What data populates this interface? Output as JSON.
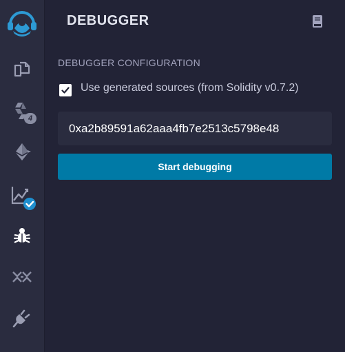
{
  "icon_bar": {
    "items": [
      {
        "name": "remix-logo-icon"
      },
      {
        "name": "file-explorer-icon"
      },
      {
        "name": "solidity-compiler-icon",
        "badge": "4"
      },
      {
        "name": "deploy-run-icon"
      },
      {
        "name": "analysis-icon",
        "badge": "check"
      },
      {
        "name": "debugger-icon",
        "active": true
      },
      {
        "name": "tests-icon"
      },
      {
        "name": "plugin-manager-icon"
      }
    ]
  },
  "panel": {
    "title": "DEBUGGER",
    "doc_icon": "documentation-icon",
    "section_label": "DEBUGGER CONFIGURATION",
    "checkbox": {
      "checked": true,
      "label": "Use generated sources (from Solidity v0.7.2)"
    },
    "tx_input": {
      "value": "0xa2b89591a62aaa4fb7e2513c5798e48",
      "placeholder": ""
    },
    "start_button": "Start debugging"
  },
  "colors": {
    "background": "#222336",
    "sidebar": "#2a2c3f",
    "accent": "#007aa6",
    "logo": "#2d9ad4",
    "check_badge": "#1e8fcf",
    "text_primary": "#e2e4ee",
    "text_muted": "#a2a3bd"
  }
}
